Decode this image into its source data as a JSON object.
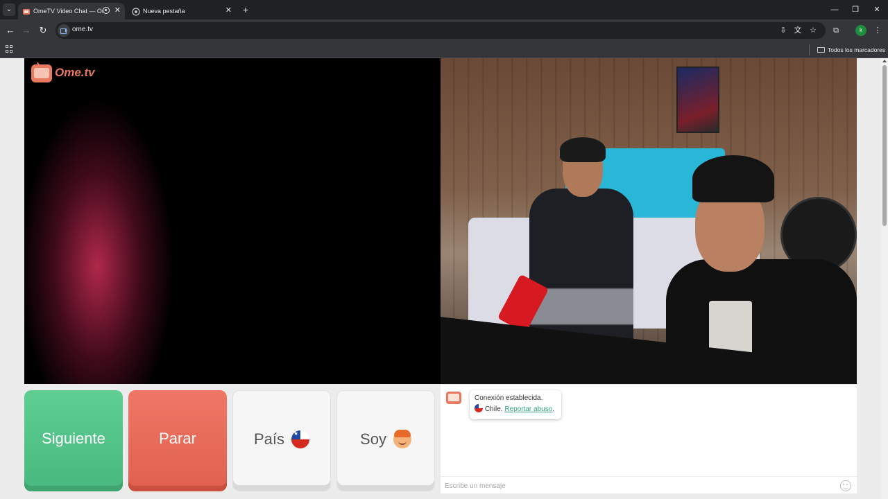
{
  "browser": {
    "tabs": [
      {
        "title": "OmeTV Video Chat — Ome",
        "active": true
      },
      {
        "title": "Nueva pestaña",
        "active": false
      }
    ],
    "url": "ome.tv",
    "profile_initial": "k",
    "bookmarks_folder": "Todos los marcadores"
  },
  "page": {
    "logo_text": "Ome.tv",
    "buttons": {
      "next": "Siguiente",
      "stop": "Parar",
      "country": "País",
      "gender": "Soy"
    },
    "chat": {
      "system_message": "Conexión establecida.",
      "country_line": "Chile.",
      "report_link": "Reportar abuso",
      "report_suffix": ".",
      "input_placeholder": "Escribe un mensaje"
    }
  },
  "colors": {
    "next_button": "#5fce93",
    "stop_button": "#f07766",
    "brand": "#e9795e",
    "link": "#36a37b"
  }
}
